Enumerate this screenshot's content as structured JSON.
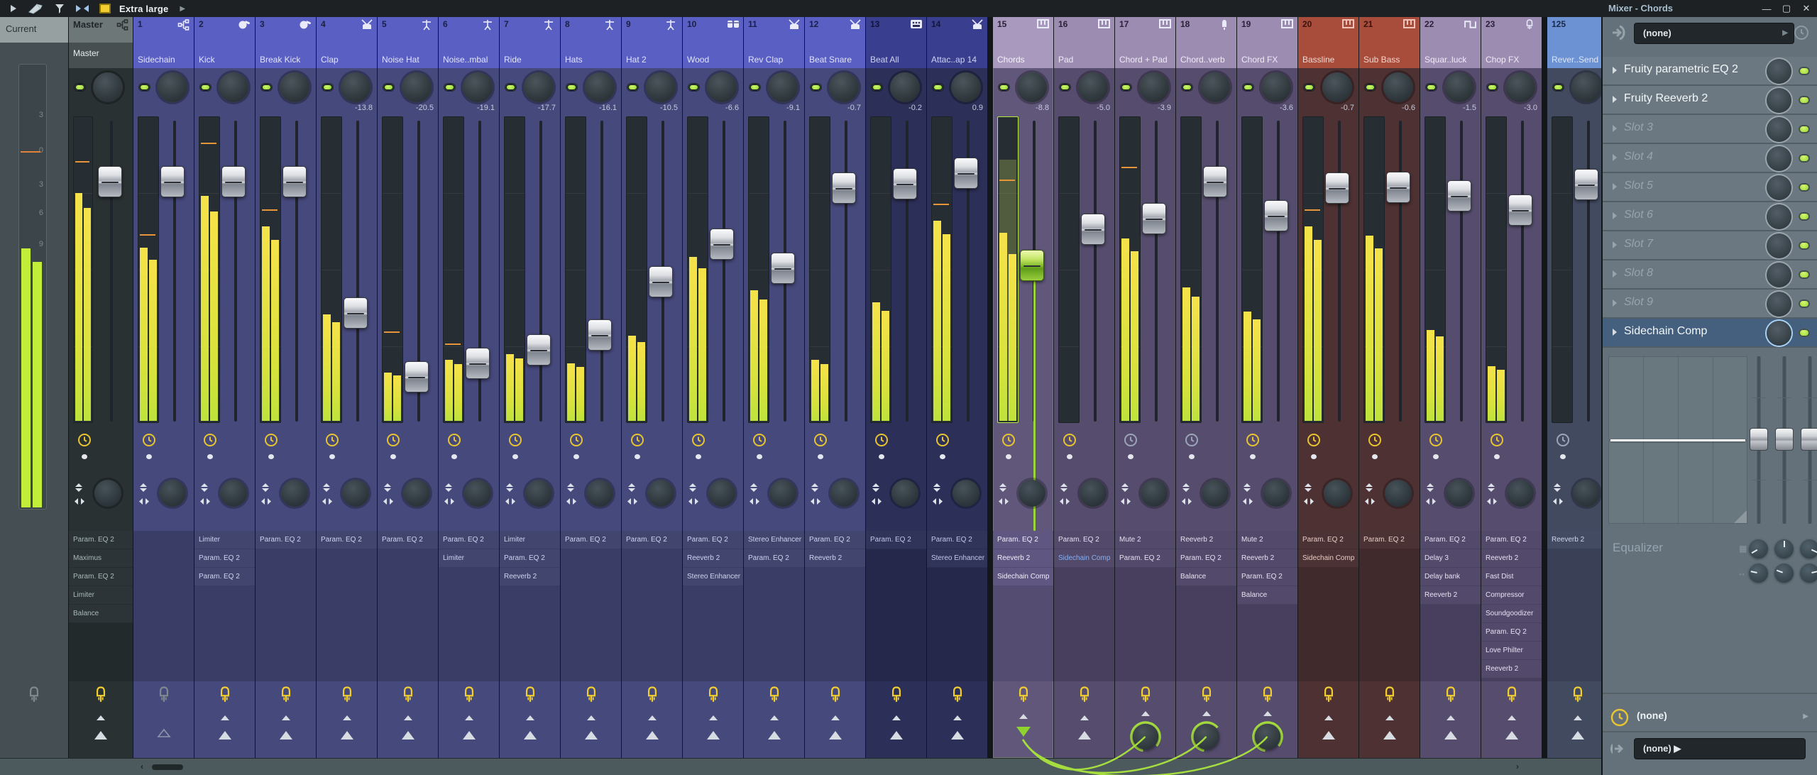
{
  "toolbar": {
    "zoom_label": "Extra large"
  },
  "window_title": "Mixer - Chords",
  "window_buttons": {
    "minimize": "—",
    "maximize": "▢",
    "close": "✕"
  },
  "panel": {
    "input_value": "(none)",
    "slots": [
      {
        "label": "Fruity parametric EQ 2",
        "filled": true
      },
      {
        "label": "Fruity Reeverb 2",
        "filled": true
      },
      {
        "label": "Slot 3",
        "filled": false
      },
      {
        "label": "Slot 4",
        "filled": false
      },
      {
        "label": "Slot 5",
        "filled": false
      },
      {
        "label": "Slot 6",
        "filled": false
      },
      {
        "label": "Slot 7",
        "filled": false
      },
      {
        "label": "Slot 8",
        "filled": false
      },
      {
        "label": "Slot 9",
        "filled": false
      },
      {
        "label": "Sidechain Comp",
        "filled": true,
        "selected": true
      }
    ],
    "equalizer_label": "Equalizer",
    "time_value": "(none)",
    "output_value": "(none)"
  },
  "colors": {
    "accent_green": "#9ade3c",
    "meter_yellow": "#f0e23e",
    "peak_orange": "#e8953a",
    "cable_green": "#a5dd3f",
    "selected_slot_blue": "#45607e",
    "plug_yellow": "#f2cf2e"
  },
  "groups": {
    "blue": {
      "header": "#5a5fc4",
      "body": "#46497b",
      "area": "#3a3d66",
      "fill": "#42466f",
      "text": "#e2e5fa",
      "num": "#1c2040",
      "ptext": "#ced3ee"
    },
    "dark": {
      "header": "#3a3e8e",
      "body": "#2c2f58",
      "area": "#25284a",
      "fill": "#303459",
      "text": "#ccd2f2",
      "num": "#121634",
      "ptext": "#c2c8ea"
    },
    "mauve": {
      "header": "#9d8cb2",
      "body": "#564d6e",
      "area": "#483f5f",
      "fill": "#534a6b",
      "text": "#efeaf8",
      "num": "#2a2138",
      "ptext": "#e6e0f2"
    },
    "mauvesel": {
      "header": "#a999be",
      "body": "#60577a",
      "area": "#554c72",
      "fill": "#605682",
      "text": "#f6f2fc",
      "num": "#2a2138",
      "ptext": "#f2eefb"
    },
    "red": {
      "header": "#a84c3c",
      "body": "#4e3132",
      "area": "#412a2b",
      "fill": "#4b3234",
      "text": "#f3d6cd",
      "num": "#3c120c",
      "ptext": "#e9cdc4"
    },
    "send": {
      "header": "#6d92d4",
      "body": "#424a60",
      "area": "#3a4156",
      "fill": "#434b63",
      "text": "#dde7f8",
      "num": "#16294a",
      "ptext": "#ccd6ee"
    },
    "master": {
      "header": "#6e7778",
      "body": "#2a3133",
      "area": "#222a2c",
      "fill": "#2c3437",
      "text": "#e8eef0",
      "num": "#24292b",
      "ptext": "#a9b9bd"
    },
    "current": {
      "header": "#97a0a0",
      "body": "#454f53",
      "area": "#454f53",
      "fill": "",
      "text": "#2a3134",
      "num": "",
      "ptext": ""
    }
  },
  "current_strip": {
    "label": "Current",
    "scale": [
      "3",
      "0",
      "3",
      "6",
      "9"
    ],
    "fills": [
      0.585,
      0.555
    ],
    "peak": 0.195
  },
  "strips": [
    {
      "type": "master",
      "num": "Master",
      "name": "Master",
      "icon": "routing",
      "group": "master",
      "db": "",
      "handle": 210,
      "fill": 0.75,
      "fill2": 0.7,
      "peak": 0.86,
      "clock": "yellow",
      "plug": "on",
      "route": "arrows",
      "plugins": [
        "Param. EQ 2",
        "Maximus",
        "Param. EQ 2",
        "Limiter",
        "Balance"
      ]
    },
    {
      "num": "1",
      "name": "Sidechain",
      "icon": "routing",
      "group": "blue",
      "db": "",
      "handle": 210,
      "fill": 0.57,
      "peak": 0.62,
      "clock": "yellow",
      "plug": "off",
      "route": "outline",
      "plugins": []
    },
    {
      "num": "2",
      "name": "Kick",
      "icon": "kick",
      "group": "blue",
      "db": "",
      "handle": 210,
      "fill": 0.74,
      "peak": 0.92,
      "clock": "yellow",
      "plug": "on",
      "route": "arrows",
      "plugins": [
        "Limiter",
        "Param. EQ 2",
        "Param. EQ 2"
      ]
    },
    {
      "num": "3",
      "name": "Break Kick",
      "icon": "kick",
      "group": "blue",
      "db": "",
      "handle": 210,
      "fill": 0.64,
      "peak": 0.7,
      "clock": "yellow",
      "plug": "on",
      "route": "arrows",
      "plugins": [
        "Param. EQ 2"
      ]
    },
    {
      "num": "4",
      "name": "Clap",
      "icon": "snare",
      "group": "blue",
      "db": "-13.8",
      "handle": 395,
      "fill": 0.35,
      "peak": 0,
      "clock": "yellow",
      "plug": "on",
      "route": "arrows",
      "plugins": [
        "Param. EQ 2"
      ]
    },
    {
      "num": "5",
      "name": "Noise Hat",
      "icon": "cymbal",
      "group": "blue",
      "db": "-20.5",
      "handle": 485,
      "fill": 0.16,
      "peak": 0.3,
      "clock": "yellow",
      "plug": "on",
      "route": "arrows",
      "plugins": [
        "Param. EQ 2"
      ]
    },
    {
      "num": "6",
      "name": "Noise..mbal",
      "icon": "cymbal",
      "group": "blue",
      "db": "-19.1",
      "handle": 466,
      "fill": 0.2,
      "peak": 0.26,
      "clock": "yellow",
      "plug": "on",
      "route": "arrows",
      "plugins": [
        "Param. EQ 2",
        "Limiter"
      ]
    },
    {
      "num": "7",
      "name": "Ride",
      "icon": "cymbal",
      "group": "blue",
      "db": "-17.7",
      "handle": 447,
      "fill": 0.22,
      "peak": 0,
      "clock": "yellow",
      "plug": "on",
      "route": "arrows",
      "plugins": [
        "Limiter",
        "Param. EQ 2",
        "Reeverb 2"
      ]
    },
    {
      "num": "8",
      "name": "Hats",
      "icon": "cymbal",
      "group": "blue",
      "db": "-16.1",
      "handle": 426,
      "fill": 0.19,
      "peak": 0,
      "clock": "yellow",
      "plug": "on",
      "route": "arrows",
      "plugins": [
        "Param. EQ 2"
      ]
    },
    {
      "num": "9",
      "name": "Hat 2",
      "icon": "cymbal",
      "group": "blue",
      "db": "-10.5",
      "handle": 351,
      "fill": 0.28,
      "peak": 0,
      "clock": "yellow",
      "plug": "on",
      "route": "arrows",
      "plugins": [
        "Param. EQ 2"
      ]
    },
    {
      "num": "10",
      "name": "Wood",
      "icon": "bongos",
      "group": "blue",
      "db": "-6.6",
      "handle": 298,
      "fill": 0.54,
      "peak": 0,
      "clock": "yellow",
      "plug": "on",
      "route": "arrows",
      "plugins": [
        "Param. EQ 2",
        "Reeverb 2",
        "Stereo Enhancer"
      ]
    },
    {
      "num": "11",
      "name": "Rev Clap",
      "icon": "snare",
      "group": "blue",
      "db": "-9.1",
      "handle": 332,
      "fill": 0.43,
      "peak": 0,
      "clock": "yellow",
      "plug": "on",
      "route": "arrows",
      "plugins": [
        "Stereo Enhancer",
        "Param. EQ 2"
      ]
    },
    {
      "num": "12",
      "name": "Beat Snare",
      "icon": "snare",
      "group": "blue",
      "db": "-0.7",
      "handle": 219,
      "fill": 0.2,
      "peak": 0,
      "clock": "yellow",
      "plug": "on",
      "route": "arrows",
      "plugins": [
        "Param. EQ 2",
        "Reeverb 2"
      ]
    },
    {
      "num": "13",
      "name": "Beat All",
      "icon": "drummachine",
      "group": "dark",
      "db": "-0.2",
      "handle": 213,
      "fill": 0.39,
      "peak": 0,
      "clock": "yellow",
      "plug": "on",
      "route": "arrows",
      "plugins": [
        "Param. EQ 2"
      ]
    },
    {
      "num": "14",
      "name": "Attac..ap 14",
      "icon": "snare",
      "group": "dark",
      "db": "0.9",
      "handle": 198,
      "fill": 0.66,
      "peak": 0.72,
      "clock": "yellow",
      "plug": "on",
      "route": "arrows",
      "plugins": [
        "Param. EQ 2",
        "Stereo Enhancer"
      ]
    },
    {
      "num": "15",
      "name": "Chords",
      "icon": "piano",
      "group": "mauvesel",
      "selected": true,
      "gapBefore": true,
      "db": "-8.8",
      "handle": 328,
      "fill": 0.62,
      "fill2": 0.55,
      "ghost": 0.86,
      "peak": 0.8,
      "clock": "yellow",
      "plug": "on",
      "route": "source",
      "plugins": [
        "Param. EQ 2",
        "Reeverb 2",
        "Sidechain Comp"
      ]
    },
    {
      "num": "16",
      "name": "Pad",
      "icon": "piano",
      "group": "mauve",
      "db": "-5.0",
      "handle": 277,
      "fill": 0,
      "peak": 0,
      "clock": "yellow",
      "plug": "on",
      "route": "arrows",
      "plugins": [
        "Param. EQ 2",
        {
          "text": "Sidechain Comp",
          "link": true
        }
      ]
    },
    {
      "num": "17",
      "name": "Chord + Pad",
      "icon": "piano",
      "group": "mauve",
      "db": "-3.9",
      "handle": 262,
      "fill": 0.6,
      "peak": 0.84,
      "clock": "grey",
      "plug": "on",
      "route": "knob",
      "arc": 300,
      "plugins": [
        "Mute 2",
        "Param. EQ 2"
      ]
    },
    {
      "num": "18",
      "name": "Chord..verb",
      "icon": "bell",
      "group": "mauve",
      "db": "",
      "handle": 210,
      "fill": 0.44,
      "peak": 0,
      "clock": "grey",
      "plug": "on",
      "route": "knob",
      "arc": 220,
      "plugins": [
        "Reeverb 2",
        "Param. EQ 2",
        "Balance"
      ]
    },
    {
      "num": "19",
      "name": "Chord FX",
      "icon": "piano",
      "group": "mauve",
      "db": "-3.6",
      "handle": 258,
      "fill": 0.36,
      "peak": 0,
      "clock": "yellow",
      "plug": "on",
      "route": "knob",
      "arc": 300,
      "plugins": [
        "Mute 2",
        "Reeverb 2",
        "Param. EQ 2",
        "Balance"
      ]
    },
    {
      "num": "20",
      "name": "Bassline",
      "icon": "piano",
      "group": "red",
      "db": "-0.7",
      "handle": 219,
      "fill": 0.64,
      "peak": 0.7,
      "clock": "yellow",
      "plug": "on",
      "route": "arrows",
      "plugins": [
        "Param. EQ 2",
        "Sidechain Comp"
      ]
    },
    {
      "num": "21",
      "name": "Sub Bass",
      "icon": "piano",
      "group": "red",
      "db": "-0.6",
      "handle": 218,
      "fill": 0.61,
      "peak": 0,
      "clock": "yellow",
      "plug": "on",
      "route": "arrows",
      "plugins": [
        "Param. EQ 2"
      ]
    },
    {
      "num": "22",
      "name": "Squar..luck",
      "icon": "squarewave",
      "group": "mauve",
      "db": "-1.5",
      "handle": 230,
      "fill": 0.3,
      "peak": 0,
      "clock": "yellow",
      "plug": "on",
      "route": "arrows",
      "plugins": [
        "Param. EQ 2",
        "Delay 3",
        "Delay bank",
        "Reeverb 2"
      ]
    },
    {
      "num": "23",
      "name": "Chop FX",
      "icon": "plugfx",
      "group": "mauve",
      "db": "-3.0",
      "handle": 250,
      "fill": 0.18,
      "peak": 0,
      "clock": "yellow",
      "plug": "on",
      "route": "arrows",
      "plugins": [
        "Param. EQ 2",
        "Reeverb 2",
        "Fast Dist",
        "Compressor",
        "Soundgoodizer",
        "Param. EQ 2",
        "Love Philter",
        "Reeverb 2"
      ]
    },
    {
      "num": "125",
      "name": "Rever..Send",
      "icon": "",
      "group": "send",
      "gapBefore": true,
      "db": "",
      "handle": 214,
      "fill": 0,
      "peak": 0,
      "clock": "grey",
      "plug": "on",
      "route": "arrows",
      "plugins": [
        "Reeverb 2"
      ]
    }
  ],
  "sidechain_links": {
    "source_track": "15",
    "target_tracks": [
      "17",
      "18",
      "19"
    ]
  }
}
